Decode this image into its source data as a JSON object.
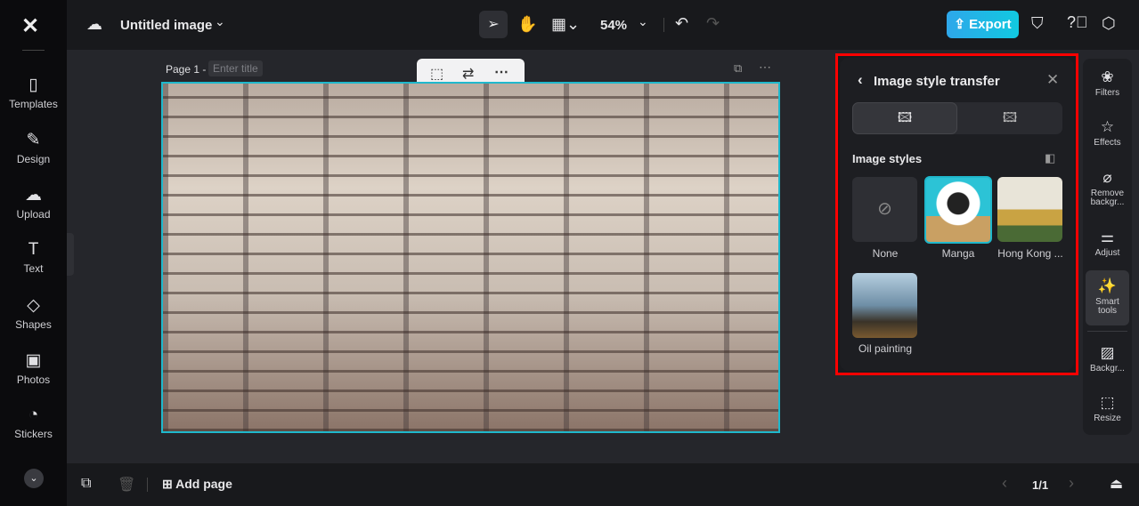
{
  "sidebar": {
    "items": [
      {
        "label": "Templates",
        "icon": "templates-icon"
      },
      {
        "label": "Design",
        "icon": "design-icon"
      },
      {
        "label": "Upload",
        "icon": "upload-icon"
      },
      {
        "label": "Text",
        "icon": "text-icon"
      },
      {
        "label": "Shapes",
        "icon": "shapes-icon"
      },
      {
        "label": "Photos",
        "icon": "photos-icon"
      },
      {
        "label": "Stickers",
        "icon": "stickers-icon"
      }
    ]
  },
  "header": {
    "title": "Untitled image",
    "zoom": "54%",
    "export_label": "Export"
  },
  "page": {
    "label": "Page 1 -",
    "title_placeholder": "Enter title"
  },
  "panel": {
    "title": "Image style transfer",
    "section": "Image styles",
    "styles": [
      {
        "label": "None"
      },
      {
        "label": "Manga"
      },
      {
        "label": "Hong Kong ..."
      },
      {
        "label": "Oil painting"
      }
    ],
    "selected": "Manga"
  },
  "tools": [
    {
      "label": "Filters"
    },
    {
      "label": "Effects"
    },
    {
      "label": "Remove backgr..."
    },
    {
      "label": "Adjust"
    },
    {
      "label": "Smart tools"
    },
    {
      "label": "Backgr..."
    },
    {
      "label": "Resize"
    }
  ],
  "footer": {
    "add_page": "Add page",
    "pager": "1/1"
  },
  "colors": {
    "accent": "#1fb8cc",
    "highlight": "#ff0000"
  }
}
